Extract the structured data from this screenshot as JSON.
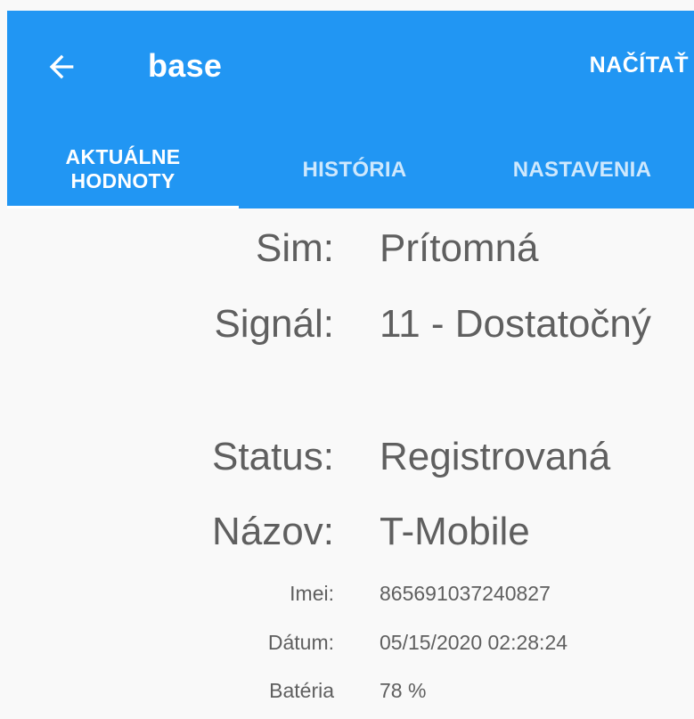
{
  "app_bar": {
    "title": "base",
    "back_icon": "arrow-left-icon",
    "action_label": "NAČÍTAŤ",
    "background": "#2196f3",
    "text_color": "#ffffff"
  },
  "tabs": [
    {
      "line1": "AKTUÁLNE",
      "line2": "HODNOTY",
      "active": true
    },
    {
      "label": "HISTÓRIA",
      "active": false
    },
    {
      "label": "NASTAVENIA",
      "active": false
    }
  ],
  "details": {
    "sim": {
      "label": "Sim:",
      "value": "Prítomná"
    },
    "signal": {
      "label": "Signál:",
      "value": "11 - Dostatočný"
    },
    "status": {
      "label": "Status:",
      "value": "Registrovaná"
    },
    "name": {
      "label": "Názov:",
      "value": "T-Mobile"
    },
    "imei": {
      "label": "Imei:",
      "value": "865691037240827"
    },
    "date": {
      "label": "Dátum:",
      "value": "05/15/2020 02:28:24"
    },
    "battery": {
      "label": "Batéria",
      "value": "78 %"
    }
  },
  "colors": {
    "page_background": "#f9f9f9",
    "text": "#5f5f5f"
  }
}
